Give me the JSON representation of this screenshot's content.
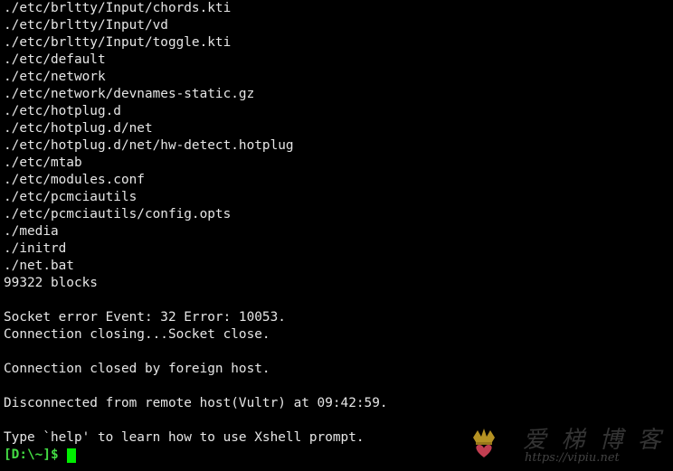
{
  "terminal": {
    "lines": [
      "./etc/brltty/Input/chords.kti",
      "./etc/brltty/Input/vd",
      "./etc/brltty/Input/toggle.kti",
      "./etc/default",
      "./etc/network",
      "./etc/network/devnames-static.gz",
      "./etc/hotplug.d",
      "./etc/hotplug.d/net",
      "./etc/hotplug.d/net/hw-detect.hotplug",
      "./etc/mtab",
      "./etc/modules.conf",
      "./etc/pcmciautils",
      "./etc/pcmciautils/config.opts",
      "./media",
      "./initrd",
      "./net.bat",
      "99322 blocks",
      "",
      "Socket error Event: 32 Error: 10053.",
      "Connection closing...Socket close.",
      "",
      "Connection closed by foreign host.",
      "",
      "Disconnected from remote host(Vultr) at 09:42:59.",
      "",
      "Type `help' to learn how to use Xshell prompt."
    ],
    "prompt": "[D:\\~]$",
    "colors": {
      "background": "#000000",
      "text": "#e6e6e6",
      "prompt": "#44dd44",
      "cursor": "#00ee00"
    }
  },
  "watermark": {
    "title": "爱 梯 博 客",
    "url": "https://vipiu.net",
    "icon": "crown-heart-logo"
  }
}
